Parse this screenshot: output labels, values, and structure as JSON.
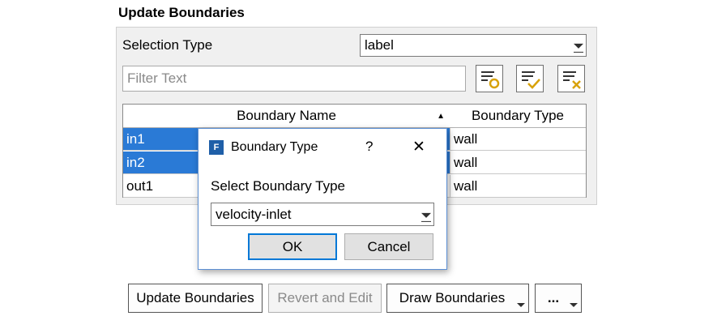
{
  "panel": {
    "title": "Update Boundaries"
  },
  "selection": {
    "label": "Selection Type",
    "value": "label"
  },
  "filter": {
    "placeholder": "Filter Text"
  },
  "toolbar_icons": [
    "filter-select-icon",
    "filter-check-icon",
    "filter-clear-icon"
  ],
  "table": {
    "headers": [
      "Boundary Name",
      "Boundary Type"
    ],
    "sort_indicator": "▲",
    "rows": [
      {
        "name": "in1",
        "type": "wall",
        "selected": true
      },
      {
        "name": "in2",
        "type": "wall",
        "selected": true
      },
      {
        "name": "out1",
        "type": "wall",
        "selected": false
      }
    ]
  },
  "dialog": {
    "title": "Boundary Type",
    "help": "?",
    "close": "✕",
    "app_icon_letter": "F",
    "prompt": "Select Boundary Type",
    "value": "velocity-inlet",
    "ok": "OK",
    "cancel": "Cancel"
  },
  "buttons": {
    "update": "Update Boundaries",
    "revert": "Revert and Edit",
    "draw": "Draw Boundaries",
    "more": "..."
  },
  "colors": {
    "selection": "#2a7ad6",
    "dialog_border": "#5b8fd4",
    "icon_accent": "#d8a20a",
    "fluent_blue": "#1f5fa8"
  }
}
